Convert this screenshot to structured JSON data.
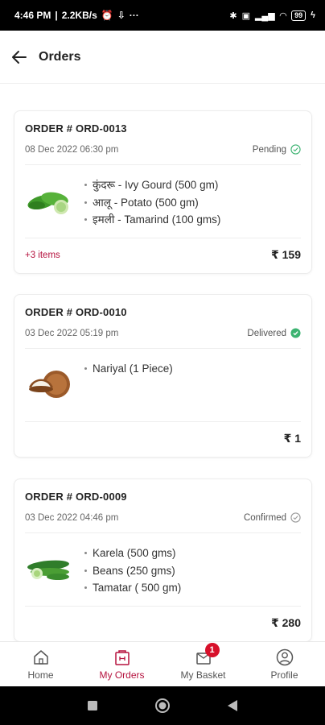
{
  "status_bar": {
    "time": "4:46 PM",
    "speed": "2.2KB/s",
    "more": "···",
    "battery": "99"
  },
  "header": {
    "title": "Orders"
  },
  "orders": [
    {
      "order_no": "ORDER # ORD-0013",
      "date": "08 Dec 2022 06:30 pm",
      "status": "Pending",
      "items": [
        "कुंदरू - Ivy Gourd (500 gm)",
        "आलू - Potato (500 gm)",
        "इमली - Tamarind (100 gms)"
      ],
      "more": "+3 items",
      "total": "₹ 159",
      "thumb_icon": "ivy-gourd-image"
    },
    {
      "order_no": "ORDER # ORD-0010",
      "date": "03 Dec 2022 05:19 pm",
      "status": "Delivered",
      "items": [
        "Nariyal (1 Piece)"
      ],
      "more": "",
      "total": "₹ 1",
      "thumb_icon": "coconut-image"
    },
    {
      "order_no": "ORDER # ORD-0009",
      "date": "03 Dec 2022 04:46 pm",
      "status": "Confirmed",
      "items": [
        "Karela (500 gms)",
        "Beans (250 gms)",
        "Tamatar ( 500 gm)"
      ],
      "more": "",
      "total": "₹ 280",
      "thumb_icon": "karela-image"
    }
  ],
  "bottom_nav": {
    "items": [
      {
        "label": "Home",
        "icon": "home-icon"
      },
      {
        "label": "My Orders",
        "icon": "orders-icon"
      },
      {
        "label": "My Basket",
        "icon": "basket-icon",
        "badge": "1"
      },
      {
        "label": "Profile",
        "icon": "profile-icon"
      }
    ]
  },
  "colors": {
    "accent": "#b5123e",
    "delivered_green": "#3cb371",
    "badge_red": "#d7102a"
  }
}
